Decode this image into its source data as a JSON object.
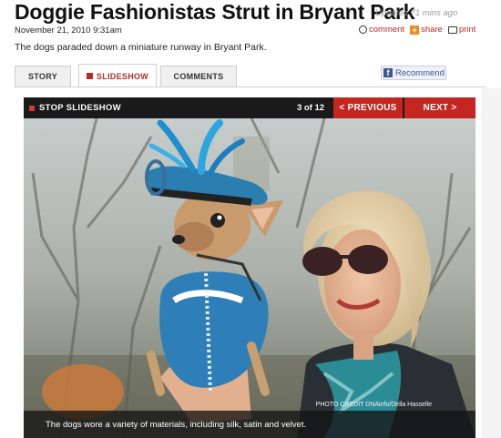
{
  "article": {
    "headline": "Doggie Fashionistas Strut in Bryant Park",
    "updated": "Updated 71 mins ago",
    "dateline": "November 21, 2010 9:31am",
    "subtitle": "The dogs paraded down a miniature runway in Bryant Park."
  },
  "actions": {
    "comment_label": "comment",
    "share_label": "share",
    "print_label": "print"
  },
  "tabs": [
    {
      "label": "STORY"
    },
    {
      "label": "SLIDESHOW"
    },
    {
      "label": "COMMENTS"
    }
  ],
  "recommend": {
    "label": "Recommend",
    "icon": "facebook-icon"
  },
  "slideshow": {
    "stop_label": "STOP SLIDESHOW",
    "counter": "3 of 12",
    "prev_label": "< PREVIOUS",
    "next_label": "NEXT >",
    "photo_credit": "PHOTO CREDIT DNAinfo/Della Hasselle",
    "caption": "The dogs wore a variety of materials, including silk, satin and velvet."
  },
  "colors": {
    "accent_red": "#c4271f",
    "bar_dark": "#1a1a1a",
    "facebook_blue": "#3b5998",
    "share_orange": "#f08a24"
  }
}
